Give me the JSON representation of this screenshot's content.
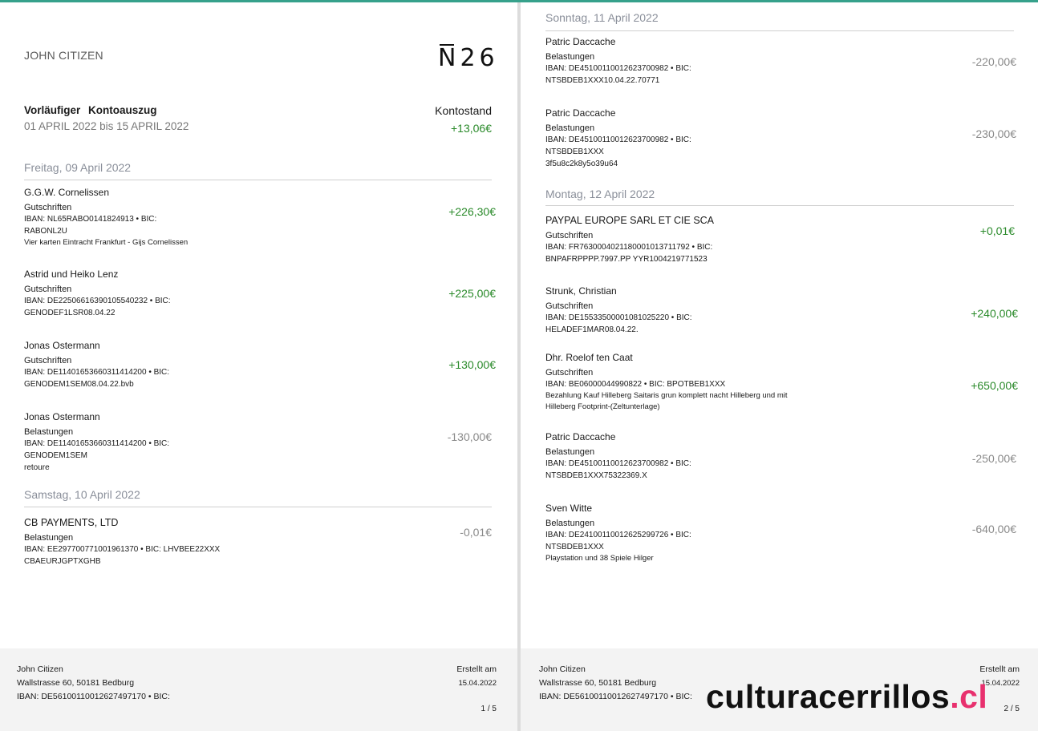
{
  "page1": {
    "holder": "JOHN CITIZEN",
    "logo": "N26",
    "title": "Vorläufiger Kontoauszug",
    "period": "01 APRIL 2022 bis 15 APRIL 2022",
    "balance_label": "Kontostand",
    "balance_value": "+13,06€",
    "days": [
      {
        "label": "Freitag, 09 April 2022",
        "transactions": [
          {
            "name": "G.G.W. Cornelissen",
            "type": "Gutschriften",
            "iban": "IBAN: NL65RABO0141824913 • BIC:",
            "bic": "RABONL2U",
            "ref": "Vier karten Eintracht Frankfurt - Gijs Cornelissen",
            "amount": "+226,30€"
          },
          {
            "name": "Astrid und Heiko Lenz",
            "type": "Gutschriften",
            "iban": "IBAN: DE22506616390105540232 • BIC:",
            "bic": "GENODEF1LSR08.04.22",
            "amount": "+225,00€"
          },
          {
            "name": "Jonas Ostermann",
            "type": "Gutschriften",
            "iban": "IBAN: DE11401653660311414200 • BIC:",
            "bic": "GENODEM1SEM08.04.22.bvb",
            "amount": "+130,00€"
          },
          {
            "name": "Jonas Ostermann",
            "type": "Belastungen",
            "iban": "IBAN: DE11401653660311414200 • BIC:",
            "bic": "GENODEM1SEM",
            "ref": "retoure",
            "amount": "-130,00€"
          }
        ]
      },
      {
        "label": "Samstag, 10 April 2022",
        "transactions": [
          {
            "name": "CB PAYMENTS, LTD",
            "type": "Belastungen",
            "iban": "IBAN: EE297700771001961370 • BIC: LHVBEE22XXX",
            "bic": "CBAEURJGPTXGHB",
            "amount": "-0,01€"
          }
        ]
      }
    ],
    "footer": {
      "name": "John Citizen",
      "address": "Wallstrasse 60, 50181 Bedburg",
      "iban": "IBAN:  DE56100110012627497170  •  BIC:",
      "created_label": "Erstellt am",
      "created_date": "15.04.2022",
      "page": "1 / 5"
    }
  },
  "page2": {
    "days": [
      {
        "label": "Sonntag, 11 April 2022",
        "transactions": [
          {
            "name": "Patric Daccache",
            "type": "Belastungen",
            "iban": "IBAN: DE45100110012623700982 • BIC:",
            "bic": "NTSBDEB1XXX10.04.22.70771",
            "amount": "-220,00€"
          },
          {
            "name": "Patric Daccache",
            "type": "Belastungen",
            "iban": "IBAN: DE45100110012623700982 • BIC:",
            "bic": "NTSBDEB1XXX",
            "ref": "3f5u8c2k8y5o39u64",
            "amount": "-230,00€"
          }
        ]
      },
      {
        "label": "Montag, 12 April 2022",
        "transactions": [
          {
            "name": "PAYPAL EUROPE SARL ET CIE SCA",
            "type": "Gutschriften",
            "iban": "IBAN: FR7630004021180001013711792 • BIC:",
            "bic": "BNPAFRPPPP.7997.PP YYR1004219771523",
            "amount": "+0,01€"
          },
          {
            "name": "Strunk, Christian",
            "type": "Gutschriften",
            "iban": "IBAN: DE15533500001081025220 • BIC:",
            "bic": "HELADEF1MAR08.04.22.",
            "amount": "+240,00€"
          },
          {
            "name": "Dhr. Roelof ten Caat",
            "type": "Gutschriften",
            "iban": "IBAN: BE06000044990822 • BIC: BPOTBEB1XXX",
            "bic": "Bezahlung Kauf Hilleberg Saitaris grun komplett nacht Hilleberg und mit",
            "ref": "Hilleberg Footprint-(Zeltunterlage)",
            "amount": "+650,00€"
          },
          {
            "name": "Patric Daccache",
            "type": "Belastungen",
            "iban": "IBAN: DE45100110012623700982 • BIC:",
            "bic": "NTSBDEB1XXX75322369.X",
            "amount": "-250,00€"
          },
          {
            "name": "Sven Witte",
            "type": "Belastungen",
            "iban": "IBAN: DE24100110012625299726 • BIC:",
            "bic": "NTSBDEB1XXX",
            "ref": "Playstation und 38 Spiele Hilger",
            "amount": "-640,00€"
          }
        ]
      }
    ],
    "footer": {
      "name": "John Citizen",
      "address": "Wallstrasse 60, 50181 Bedburg",
      "iban": "IBAN:  DE56100110012627497170  •  BIC:",
      "created_label": "Erstellt am",
      "created_date": "15.04.2022",
      "page": "2 / 5"
    }
  },
  "watermark": {
    "text": "culturacerrillos",
    "suffix": ".cl",
    "accent": "#e8306e"
  },
  "colors": {
    "top_bar": "#36a18b",
    "positive": "#2a8a2a",
    "negative": "#8a8a8a",
    "day_header": "#8a8f9a"
  }
}
